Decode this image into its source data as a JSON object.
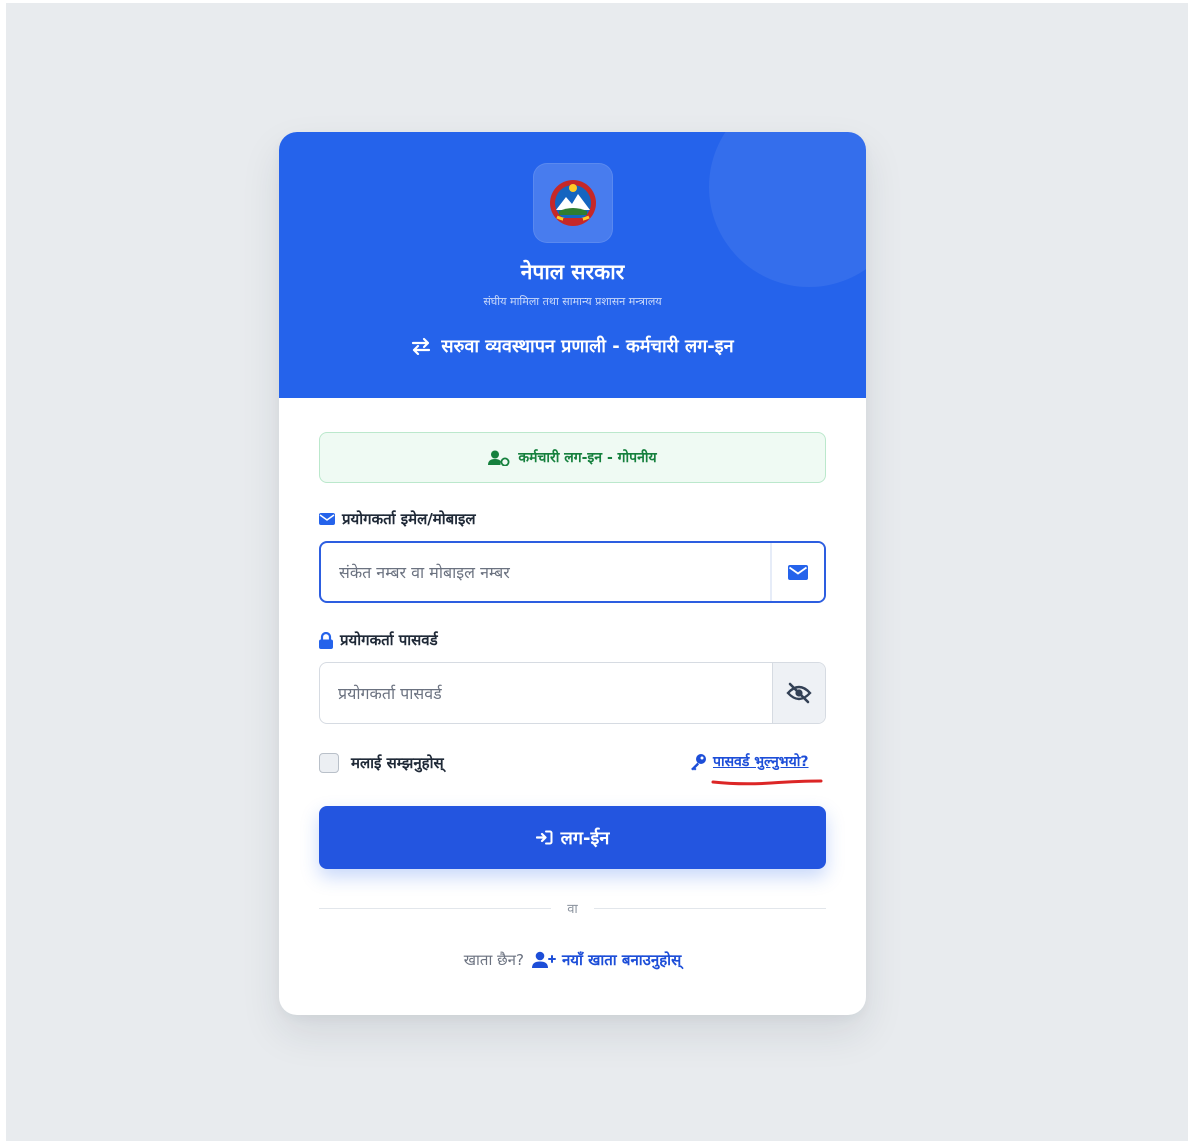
{
  "header": {
    "org_title": "नेपाल सरकार",
    "org_subtitle": "संघीय मामिला तथा सामान्य प्रशासन मन्त्रालय",
    "system_title": "सरुवा व्यवस्थापन प्रणाली - कर्मचारी लग-इन",
    "system_icon": "exchange-arrows-icon",
    "logo": "nepal-emblem-icon"
  },
  "notice": {
    "text": "कर्मचारी लग-इन - गोपनीय",
    "icon": "user-shield-icon"
  },
  "username": {
    "label": "प्रयोगकर्ता इमेल/मोबाइल",
    "placeholder": "संकेत नम्बर वा मोबाइल नम्बर",
    "value": "",
    "icon": "envelope-icon"
  },
  "password": {
    "label": "प्रयोगकर्ता पासवर्ड",
    "placeholder": "प्रयोगकर्ता पासवर्ड",
    "value": "",
    "icon": "lock-icon",
    "toggle_icon": "eye-slash-icon"
  },
  "remember": {
    "label": "मलाई सम्झनुहोस्",
    "checked": false
  },
  "forgot": {
    "label": "पासवर्ड भुल्नुभयो?",
    "icon": "key-icon"
  },
  "login_button": {
    "label": "लग-ईन",
    "icon": "sign-in-icon"
  },
  "divider_text": "वा",
  "signup": {
    "question": "खाता छैन?",
    "link": "नयाँ खाता बनाउनुहोस्",
    "icon": "user-plus-icon"
  },
  "colors": {
    "primary": "#2563eb",
    "page_bg": "#e8ebee",
    "success": "#15803d",
    "annotation_red": "#dc2626"
  }
}
